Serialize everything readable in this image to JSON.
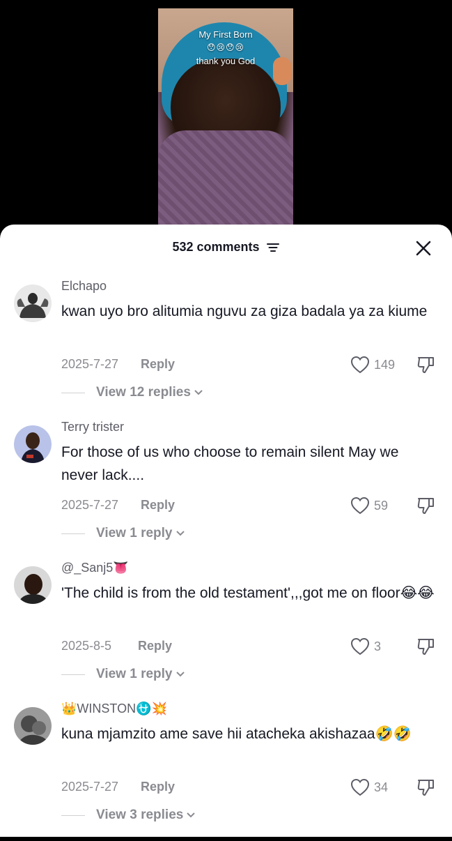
{
  "video": {
    "caption_line1": "My First Born",
    "caption_emojis": "😯😢😯😢",
    "caption_line2": "thank you God"
  },
  "sheet": {
    "comment_count": "532 comments",
    "filter_icon": "filter-icon",
    "close_icon": "close-icon"
  },
  "comments": [
    {
      "username": "Elchapo",
      "text": "kwan uyo bro alitumia nguvu za giza badala ya za kiume",
      "date": "2025-7-27",
      "reply_label": "Reply",
      "likes": "149",
      "view_replies": "View 12 replies",
      "avatar_color": "#8a8a8a"
    },
    {
      "username": "Terry trister",
      "text": "For those of us who choose to remain silent May we never lack....",
      "date": "2025-7-27",
      "reply_label": "Reply",
      "likes": "59",
      "view_replies": "View 1 reply",
      "avatar_color": "#7b7fc4"
    },
    {
      "username": "@_Sanj5👅",
      "text": "'The child is from the old testament',,,got me on floor😂😂",
      "date": "2025-8-5",
      "reply_label": "Reply",
      "likes": "3",
      "view_replies": "View 1 reply",
      "avatar_color": "#3a3a3a"
    },
    {
      "username": "👑WINSTON⛎💥",
      "text": "kuna mjamzito ame save hii atacheka akishazaa🤣🤣",
      "date": "2025-7-27",
      "reply_label": "Reply",
      "likes": "34",
      "view_replies": "View 3 replies",
      "avatar_color": "#6a6a6a"
    }
  ],
  "colors": {
    "primary_text": "#161823",
    "secondary_text": "#8a8b91",
    "username_text": "#5c5d66"
  }
}
